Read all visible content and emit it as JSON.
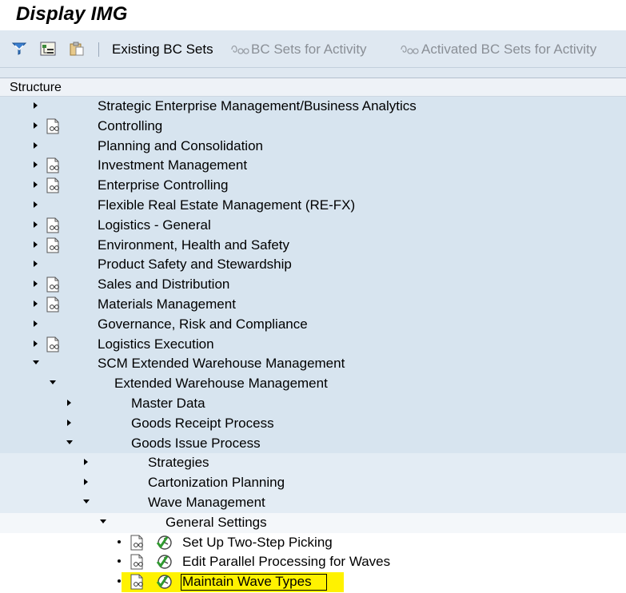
{
  "window": {
    "title": "Display IMG"
  },
  "toolbar": {
    "existing_bc_sets": "Existing BC Sets",
    "bc_sets_for_activity": "BC Sets for Activity",
    "activated_bc_sets_for_activity": "Activated BC Sets for Activity",
    "icons": [
      "filter-funnel-icon",
      "structure-expand-icon",
      "clipboard-icon",
      "bc-set-icon"
    ]
  },
  "structure": {
    "header": "Structure",
    "rows": [
      {
        "label": "Strategic Enterprise Management/Business Analytics",
        "level": 0,
        "toggle": "collapsed",
        "doc": false
      },
      {
        "label": "Controlling",
        "level": 0,
        "toggle": "collapsed",
        "doc": true
      },
      {
        "label": "Planning and Consolidation",
        "level": 0,
        "toggle": "collapsed",
        "doc": false
      },
      {
        "label": "Investment Management",
        "level": 0,
        "toggle": "collapsed",
        "doc": true
      },
      {
        "label": "Enterprise Controlling",
        "level": 0,
        "toggle": "collapsed",
        "doc": true
      },
      {
        "label": "Flexible Real Estate Management (RE-FX)",
        "level": 0,
        "toggle": "collapsed",
        "doc": false
      },
      {
        "label": "Logistics - General",
        "level": 0,
        "toggle": "collapsed",
        "doc": true
      },
      {
        "label": "Environment, Health and Safety",
        "level": 0,
        "toggle": "collapsed",
        "doc": true
      },
      {
        "label": "Product Safety and Stewardship",
        "level": 0,
        "toggle": "collapsed",
        "doc": false
      },
      {
        "label": "Sales and Distribution",
        "level": 0,
        "toggle": "collapsed",
        "doc": true
      },
      {
        "label": "Materials Management",
        "level": 0,
        "toggle": "collapsed",
        "doc": true
      },
      {
        "label": "Governance, Risk and Compliance",
        "level": 0,
        "toggle": "collapsed",
        "doc": false
      },
      {
        "label": "Logistics Execution",
        "level": 0,
        "toggle": "collapsed",
        "doc": true
      },
      {
        "label": "SCM Extended Warehouse Management",
        "level": 0,
        "toggle": "expanded",
        "doc": false
      },
      {
        "label": "Extended Warehouse Management",
        "level": 1,
        "toggle": "expanded",
        "doc": false
      },
      {
        "label": "Master Data",
        "level": 2,
        "toggle": "collapsed",
        "doc": false
      },
      {
        "label": "Goods Receipt Process",
        "level": 2,
        "toggle": "collapsed",
        "doc": false
      },
      {
        "label": "Goods Issue Process",
        "level": 2,
        "toggle": "expanded",
        "doc": false
      },
      {
        "label": "Strategies",
        "level": 3,
        "toggle": "collapsed",
        "doc": false
      },
      {
        "label": "Cartonization Planning",
        "level": 3,
        "toggle": "collapsed",
        "doc": false
      },
      {
        "label": "Wave Management",
        "level": 3,
        "toggle": "expanded",
        "doc": false
      },
      {
        "label": "General Settings",
        "level": 4,
        "toggle": "expanded",
        "doc": false
      },
      {
        "label": "Set Up Two-Step Picking",
        "level": 5,
        "toggle": "leaf",
        "doc": true,
        "exec": true
      },
      {
        "label": "Edit Parallel Processing for Waves",
        "level": 5,
        "toggle": "leaf",
        "doc": true,
        "exec": true
      },
      {
        "label": "Maintain Wave Types",
        "level": 5,
        "toggle": "leaf",
        "doc": true,
        "exec": true,
        "selected": true
      }
    ]
  }
}
